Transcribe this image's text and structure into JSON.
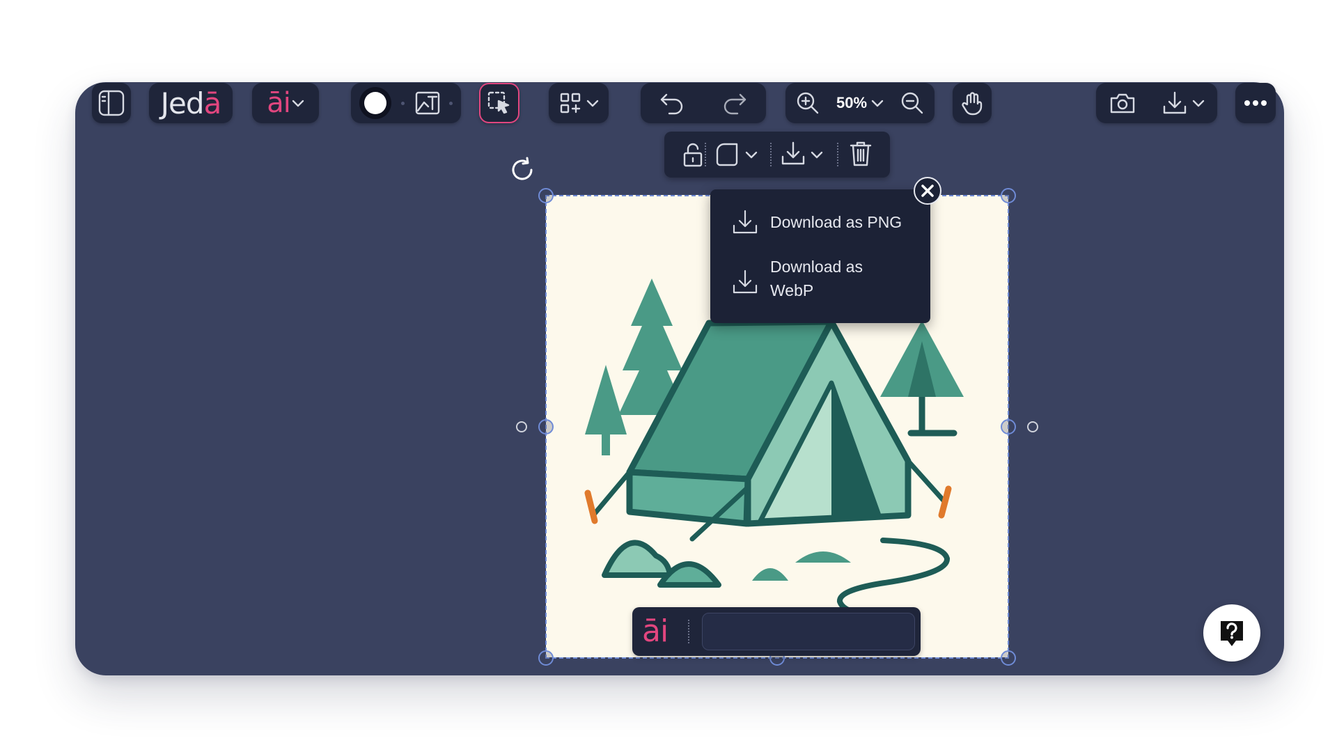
{
  "toolbar": {
    "brand_main": "Jed",
    "brand_accent": "ā",
    "ai_menu_label": "āi",
    "zoom_level": "50%"
  },
  "download_menu": {
    "items": [
      {
        "label": "Download as PNG",
        "icon": "download-icon"
      },
      {
        "label": "Download as WebP",
        "icon": "download-icon"
      }
    ]
  },
  "ai_prompt": {
    "label": "āi",
    "placeholder": ""
  },
  "colors": {
    "canvas": "#3a4260",
    "panel": "#1f253a",
    "accent": "#e2467f",
    "selection": "#6f8bd6",
    "image_bg": "#fdf9ec",
    "tent": "#4a9a86"
  },
  "icons": [
    "sidebar-toggle-icon",
    "color-circle-icon",
    "image-text-icon",
    "select-cursor-icon",
    "add-widget-icon",
    "undo-icon",
    "redo-icon",
    "zoom-in-icon",
    "zoom-out-icon",
    "hand-icon",
    "camera-icon",
    "download-icon",
    "more-icon",
    "lock-icon",
    "shape-icon",
    "trash-icon",
    "rotate-icon",
    "close-icon",
    "help-icon"
  ]
}
